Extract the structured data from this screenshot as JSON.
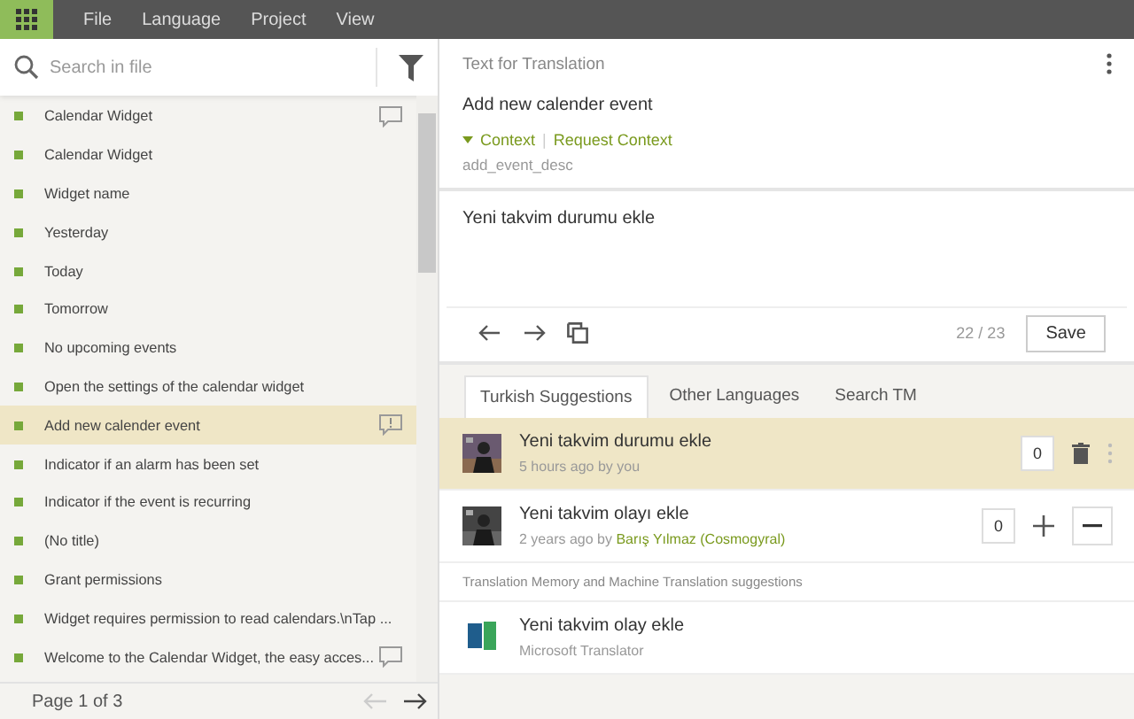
{
  "menu": [
    "File",
    "Language",
    "Project",
    "View"
  ],
  "search": {
    "placeholder": "Search in file"
  },
  "strings": [
    {
      "text": "Calendar Widget",
      "selected": false,
      "kind": "commented"
    },
    {
      "text": "Calendar Widget",
      "selected": false,
      "kind": "plain"
    },
    {
      "text": "Widget name",
      "selected": false,
      "kind": "plain"
    },
    {
      "text": "Yesterday",
      "selected": false,
      "kind": "plain"
    },
    {
      "text": "Today",
      "selected": false,
      "kind": "plain"
    },
    {
      "text": "Tomorrow",
      "selected": false,
      "kind": "plain"
    },
    {
      "text": "No upcoming events",
      "selected": false,
      "kind": "plain"
    },
    {
      "text": "Open the settings of the calendar widget",
      "selected": false,
      "kind": "plain"
    },
    {
      "text": "Add new calender event",
      "selected": true,
      "kind": "issue"
    },
    {
      "text": "Indicator if an alarm has been set",
      "selected": false,
      "kind": "plain"
    },
    {
      "text": "Indicator if the event is recurring",
      "selected": false,
      "kind": "plain"
    },
    {
      "text": "(No title)",
      "selected": false,
      "kind": "plain"
    },
    {
      "text": "Grant permissions",
      "selected": false,
      "kind": "plain"
    },
    {
      "text": "Widget requires permission to read calendars.\\nTap ...",
      "selected": false,
      "kind": "plain"
    },
    {
      "text": "Welcome to the Calendar Widget, the easy acces...",
      "selected": false,
      "kind": "commented"
    }
  ],
  "pager": {
    "label": "Page 1 of 3"
  },
  "source": {
    "heading": "Text for Translation",
    "text": "Add new calender event",
    "context_link": "Context",
    "separator": "|",
    "request_link": "Request Context",
    "context": "add_event_desc"
  },
  "editor": {
    "value": "Yeni takvim durumu ekle",
    "counter": "22 / 23",
    "save": "Save"
  },
  "tabs": [
    {
      "label": "Turkish Suggestions",
      "selected": true
    },
    {
      "label": "Other Languages",
      "selected": false
    },
    {
      "label": "Search TM",
      "selected": false
    }
  ],
  "suggestions": [
    {
      "text": "Yeni takvim durumu ekle",
      "meta": "5 hours ago by you",
      "votes": "0",
      "mine": true
    },
    {
      "text": "Yeni takvim olayı ekle",
      "meta": "2 years ago by ",
      "author": "Barış Yılmaz (Cosmogyral)",
      "votes": "0",
      "mine": false
    }
  ],
  "tm_heading": "Translation Memory and Machine Translation suggestions",
  "machine": [
    {
      "text": "Yeni takvim olay ekle",
      "source": "Microsoft Translator"
    }
  ]
}
